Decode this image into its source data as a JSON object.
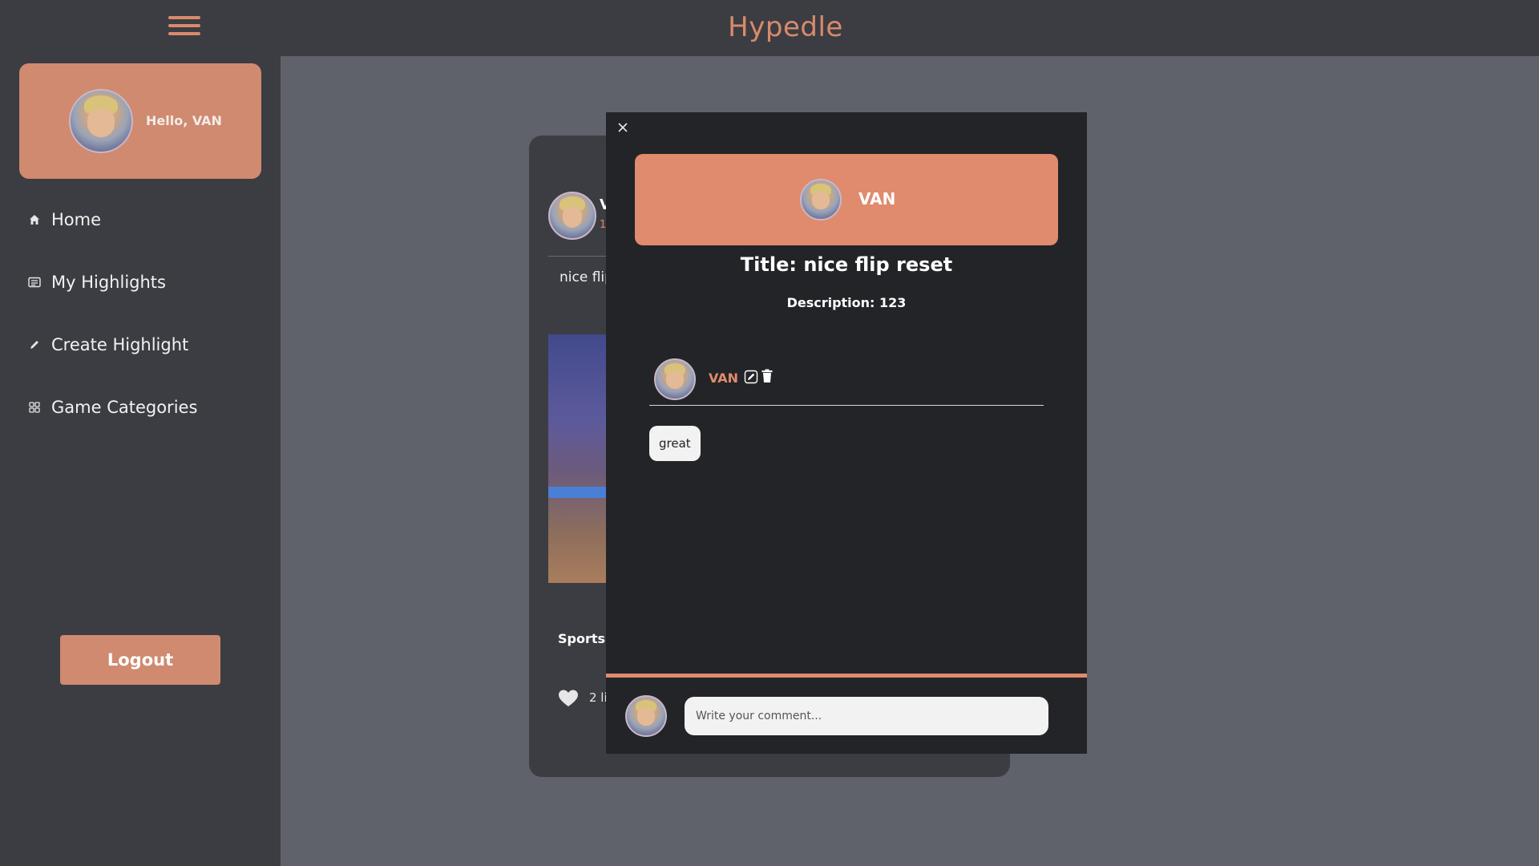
{
  "app": {
    "brand": "Hypedle"
  },
  "sidebar": {
    "greeting": "Hello, VAN",
    "items": [
      {
        "label": "Home",
        "icon": "home-icon"
      },
      {
        "label": "My Highlights",
        "icon": "list-icon"
      },
      {
        "label": "Create Highlight",
        "icon": "pencil-icon"
      },
      {
        "label": "Game Categories",
        "icon": "grid-icon"
      }
    ],
    "logout_label": "Logout"
  },
  "post": {
    "author": "V",
    "date": "1",
    "title": "nice flip",
    "category": "Sports",
    "likes": "2 li"
  },
  "modal": {
    "author": "VAN",
    "title": "Title: nice flip reset",
    "description": "Description: 123",
    "comment": {
      "author": "VAN",
      "text": "great"
    },
    "input_placeholder": "Write your comment..."
  },
  "colors": {
    "accent": "#e08b6d",
    "background": "#5f616b",
    "panel": "#3c3d42",
    "modal": "#232428"
  }
}
